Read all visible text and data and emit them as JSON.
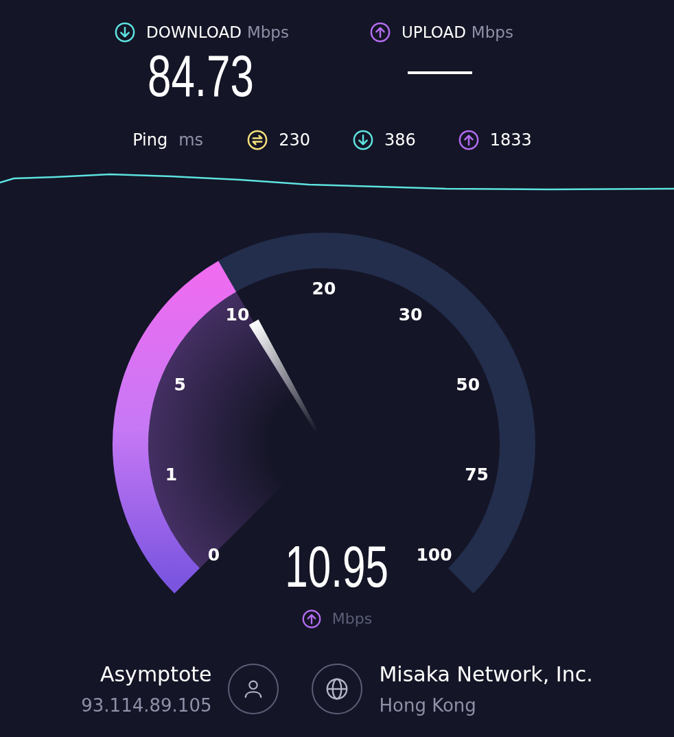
{
  "download": {
    "label": "DOWNLOAD",
    "unit": "Mbps",
    "value": "84.73"
  },
  "upload": {
    "label": "UPLOAD",
    "unit": "Mbps",
    "pending": true
  },
  "ping": {
    "label": "Ping",
    "unit": "ms",
    "items": [
      {
        "kind": "idle",
        "value": "230"
      },
      {
        "kind": "download",
        "value": "386"
      },
      {
        "kind": "upload",
        "value": "1833"
      }
    ]
  },
  "gauge": {
    "scale": [
      "0",
      "1",
      "5",
      "10",
      "20",
      "30",
      "50",
      "75",
      "100"
    ],
    "reading": "10.95",
    "unit": "Mbps",
    "uploading": true
  },
  "client": {
    "name": "Asymptote",
    "ip": "93.114.89.105"
  },
  "server": {
    "name": "Misaka Network, Inc.",
    "location": "Hong Kong"
  }
}
